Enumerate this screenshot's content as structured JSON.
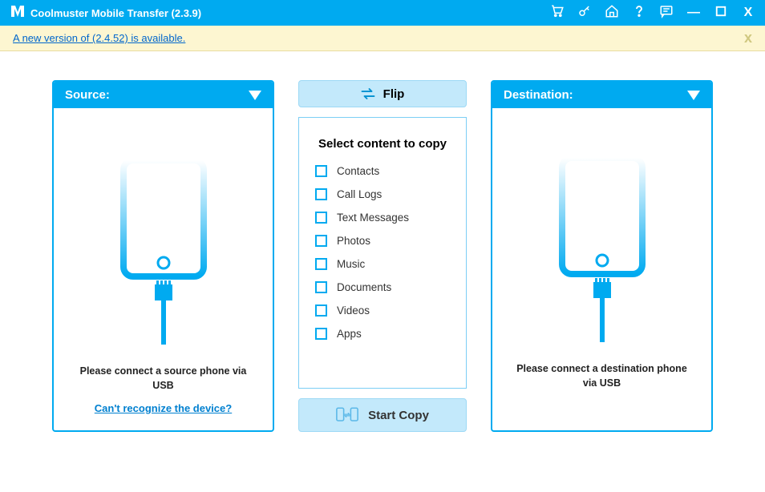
{
  "titlebar": {
    "title": "Coolmuster Mobile Transfer (2.3.9)"
  },
  "banner": {
    "text": "A new version of (2.4.52) is available."
  },
  "source": {
    "header": "Source:",
    "msg": "Please connect a source phone via USB",
    "link": "Can't recognize the device?"
  },
  "destination": {
    "header": "Destination:",
    "msg": "Please connect a destination phone via USB"
  },
  "middle": {
    "flip": "Flip",
    "select_title": "Select content to copy",
    "items": [
      "Contacts",
      "Call Logs",
      "Text Messages",
      "Photos",
      "Music",
      "Documents",
      "Videos",
      "Apps"
    ],
    "start": "Start Copy"
  }
}
